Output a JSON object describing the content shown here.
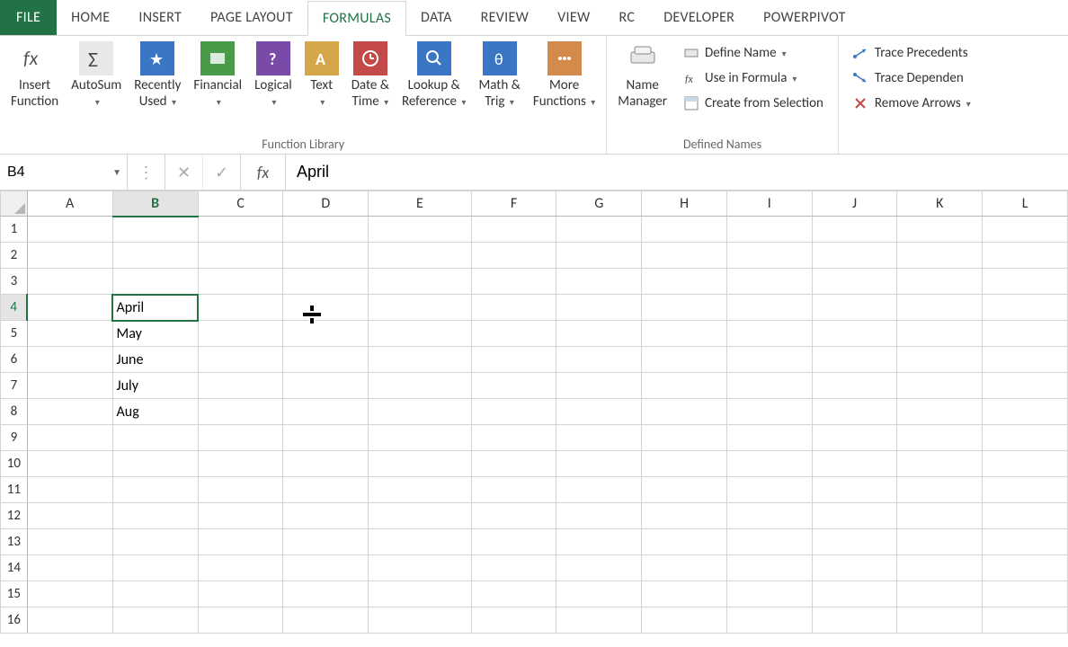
{
  "tabs": {
    "file": "FILE",
    "home": "HOME",
    "insert": "INSERT",
    "page_layout": "PAGE LAYOUT",
    "formulas": "FORMULAS",
    "data": "DATA",
    "review": "REVIEW",
    "view": "VIEW",
    "rc": "RC",
    "developer": "DEVELOPER",
    "powerpivot": "POWERPIVOT"
  },
  "ribbon": {
    "insert_function": "Insert\nFunction",
    "autosum": "AutoSum",
    "recently_used": "Recently\nUsed",
    "financial": "Financial",
    "logical": "Logical",
    "text": "Text",
    "date_time": "Date &\nTime",
    "lookup_ref": "Lookup &\nReference",
    "math_trig": "Math &\nTrig",
    "more_functions": "More\nFunctions",
    "function_library": "Function Library",
    "name_manager": "Name\nManager",
    "define_name": "Define Name",
    "use_in_formula": "Use in Formula",
    "create_selection": "Create from Selection",
    "defined_names": "Defined Names",
    "trace_precedents": "Trace Precedents",
    "trace_dependents": "Trace Dependen",
    "remove_arrows": "Remove Arrows"
  },
  "formula_bar": {
    "name_box": "B4",
    "formula": "April"
  },
  "columns": [
    "A",
    "B",
    "C",
    "D",
    "E",
    "F",
    "G",
    "H",
    "I",
    "J",
    "K",
    "L"
  ],
  "col_widths": {
    "A": 96,
    "B": 96,
    "C": 96,
    "D": 96,
    "E": 116,
    "F": 96,
    "G": 96,
    "H": 96,
    "I": 96,
    "J": 96,
    "K": 96,
    "L": 96
  },
  "rows": [
    "1",
    "2",
    "3",
    "4",
    "5",
    "6",
    "7",
    "8",
    "9",
    "10",
    "11",
    "12",
    "13",
    "14",
    "15",
    "16"
  ],
  "selected": {
    "col": "B",
    "row": "4"
  },
  "cells": {
    "B4": "April",
    "B5": "May",
    "B6": "June",
    "B7": "July",
    "B8": "Aug"
  }
}
